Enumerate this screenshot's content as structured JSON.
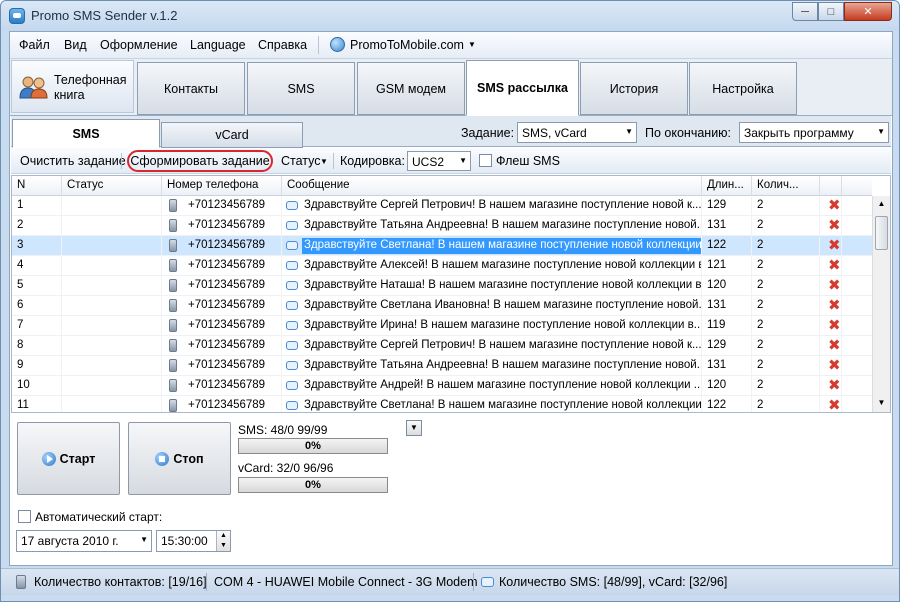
{
  "window": {
    "title": "Promo SMS Sender v.1.2"
  },
  "menu": {
    "file": "Файл",
    "view": "Вид",
    "design": "Оформление",
    "language": "Language",
    "help": "Справка",
    "promo": "PromoToMobile.com"
  },
  "tabs": {
    "phonebook": "Телефонная книга",
    "items": [
      "Контакты",
      "SMS",
      "GSM модем",
      "SMS рассылка",
      "История",
      "Настройка"
    ]
  },
  "subtabs": {
    "sms": "SMS",
    "vcard": "vCard"
  },
  "task": {
    "label": "Задание:",
    "value": "SMS, vCard"
  },
  "on_end": {
    "label": "По окончанию:",
    "value": "Закрыть программу"
  },
  "toolbar": {
    "clear": "Очистить задание",
    "form": "Сформировать задание",
    "status": "Статус",
    "encoding_label": "Кодировка:",
    "encoding_value": "UCS2",
    "flash": "Флеш SMS"
  },
  "grid": {
    "headers": [
      "N",
      "Статус",
      "Номер телефона",
      "Сообщение",
      "Длин...",
      "Колич..."
    ],
    "rows": [
      {
        "n": "1",
        "phone": "+70123456789",
        "message": "Здравствуйте Сергей Петрович! В нашем магазине поступление новой к...",
        "length": "129",
        "count": "2"
      },
      {
        "n": "2",
        "phone": "+70123456789",
        "message": "Здравствуйте Татьяна Андреевна! В нашем магазине поступление новой...",
        "length": "131",
        "count": "2"
      },
      {
        "n": "3",
        "phone": "+70123456789",
        "message": "Здравствуйте Светлана! В нашем магазине поступление новой коллекции в",
        "length": "122",
        "count": "2",
        "selected": true
      },
      {
        "n": "4",
        "phone": "+70123456789",
        "message": "Здравствуйте Алексей! В нашем магазине поступление новой коллекции в...",
        "length": "121",
        "count": "2"
      },
      {
        "n": "5",
        "phone": "+70123456789",
        "message": "Здравствуйте Наташа! В нашем магазине поступление новой коллекции в ...",
        "length": "120",
        "count": "2"
      },
      {
        "n": "6",
        "phone": "+70123456789",
        "message": "Здравствуйте Светлана Ивановна! В нашем магазине поступление новой...",
        "length": "131",
        "count": "2"
      },
      {
        "n": "7",
        "phone": "+70123456789",
        "message": "Здравствуйте Ирина! В нашем магазине поступление новой коллекции в...",
        "length": "119",
        "count": "2"
      },
      {
        "n": "8",
        "phone": "+70123456789",
        "message": "Здравствуйте Сергей Петрович! В нашем магазине поступление новой к...",
        "length": "129",
        "count": "2"
      },
      {
        "n": "9",
        "phone": "+70123456789",
        "message": "Здравствуйте Татьяна Андреевна! В нашем магазине поступление новой...",
        "length": "131",
        "count": "2"
      },
      {
        "n": "10",
        "phone": "+70123456789",
        "message": "Здравствуйте Андрей! В нашем магазине поступление новой коллекции ...",
        "length": "120",
        "count": "2"
      },
      {
        "n": "11",
        "phone": "+70123456789",
        "message": "Здравствуйте Светлана! В нашем магазине поступление новой коллекции ...",
        "length": "122",
        "count": "2"
      }
    ]
  },
  "controls": {
    "start": "Старт",
    "stop": "Стоп",
    "sms_label": "SMS:  48/0   99/99",
    "sms_progress_text": "0%",
    "sms_progress": 0,
    "vcard_label": "vCard:  32/0   96/96",
    "vcard_progress_text": "0%",
    "vcard_progress": 0,
    "auto_start": "Автоматический старт:",
    "date": "17  августа  2010 г.",
    "time": "15:30:00"
  },
  "statusbar": {
    "contacts": "Количество контактов: [19/16]",
    "com": "COM 4 - HUAWEI Mobile Connect - 3G Modem",
    "sms": "Количество SMS: [48/99], vCard: [32/96]"
  },
  "colors": {
    "selection": "#3399ff",
    "form_outline": "#d9262b",
    "delete": "#d63a2f"
  }
}
